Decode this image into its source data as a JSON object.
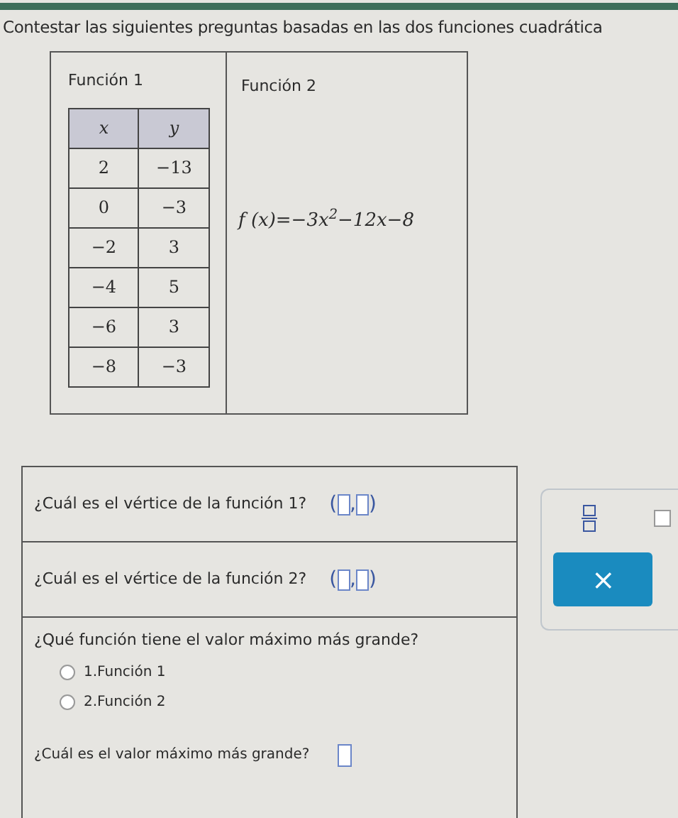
{
  "instruction": "Contestar las siguientes preguntas basadas en las dos funciones cuadrática",
  "function_1": {
    "title": "Función 1",
    "table": {
      "columns": [
        "x",
        "y"
      ],
      "rows": [
        [
          "2",
          "−13"
        ],
        [
          "0",
          "−3"
        ],
        [
          "−2",
          "3"
        ],
        [
          "−4",
          "5"
        ],
        [
          "−6",
          "3"
        ],
        [
          "−8",
          "−3"
        ]
      ]
    }
  },
  "function_2": {
    "title": "Función 2",
    "formula": "f (x)=−3x$^{2}$−12x−8"
  },
  "questions": [
    {
      "kind": "pair",
      "text": "¿Cuál es el vértice de la función 1?",
      "open": "(",
      "separator": ",",
      "close": ")"
    },
    {
      "kind": "pair",
      "text": "¿Cuál es el vértice de la función 2?",
      "open": "(",
      "separator": ",",
      "close": ")"
    },
    {
      "kind": "choice",
      "text": "¿Qué función tiene el valor máximo más grande?",
      "options": [
        {
          "label": "1.Función 1",
          "selected": false
        },
        {
          "label": "2.Función 2",
          "selected": false
        }
      ]
    },
    {
      "kind": "single",
      "text": "¿Cuál es el valor máximo más grande?"
    }
  ],
  "palette": {
    "clear_button": "×"
  }
}
